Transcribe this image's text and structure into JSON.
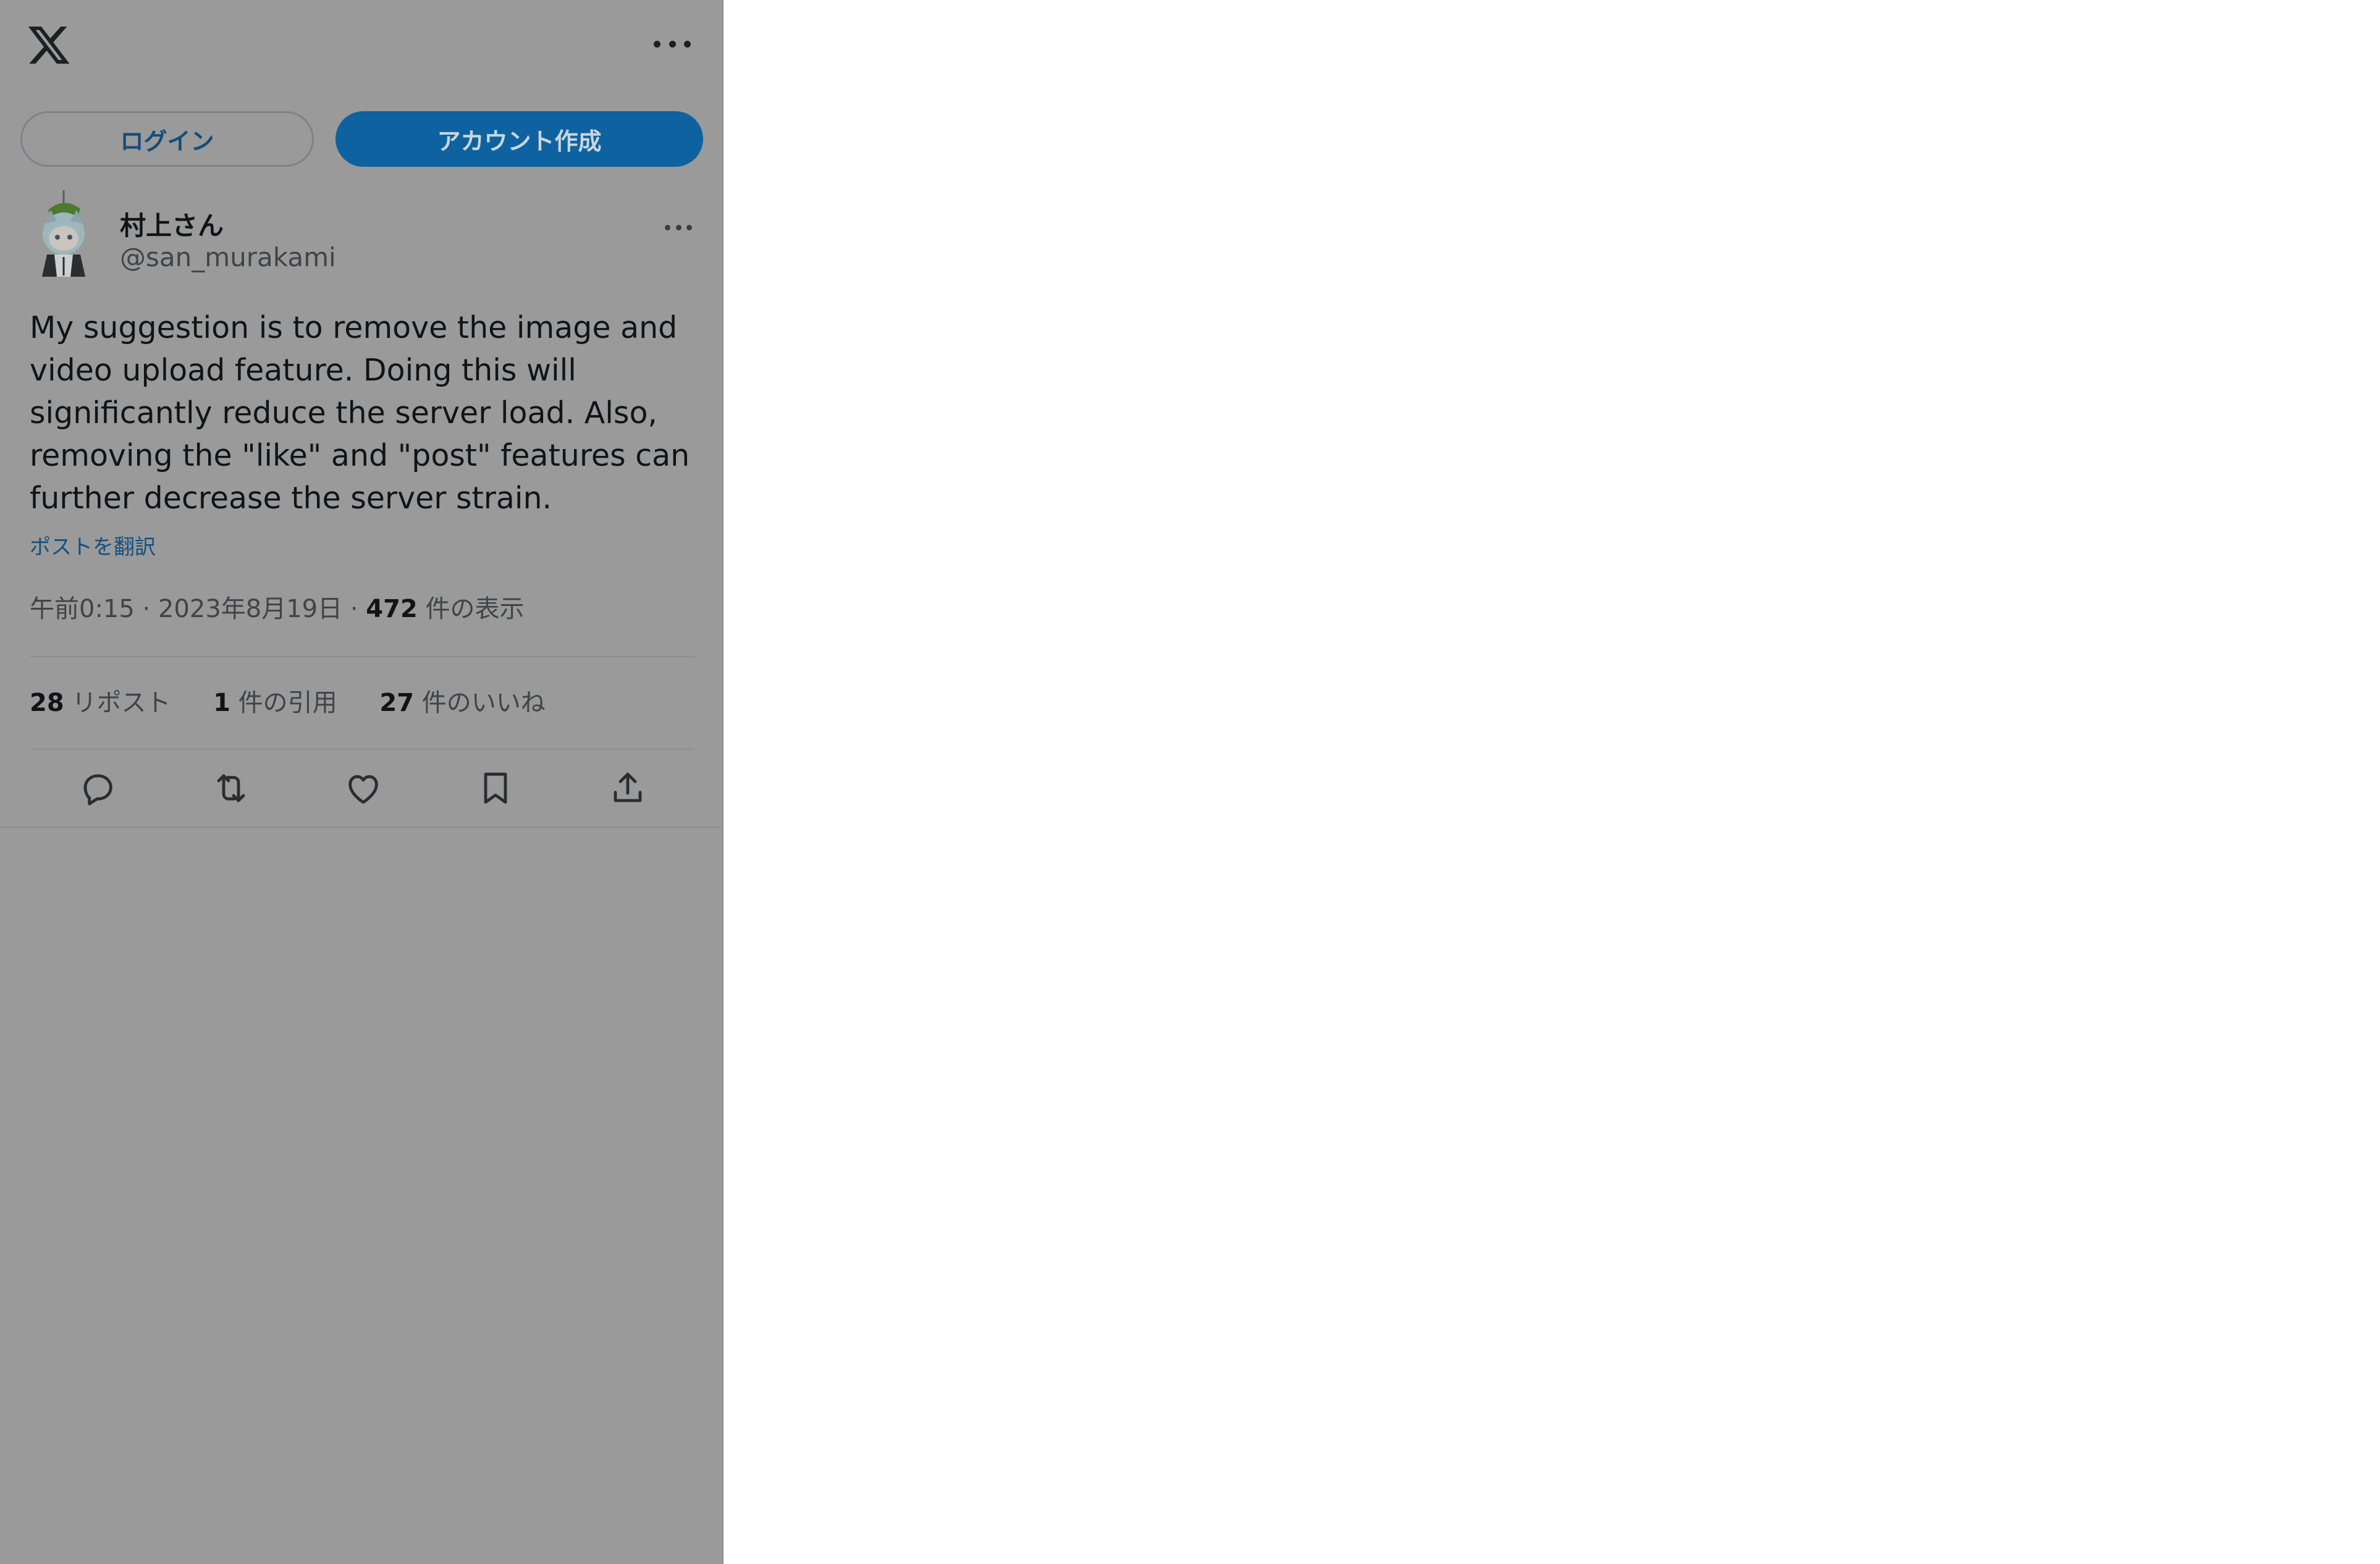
{
  "window": {
    "logo_icon": "x-logo-icon",
    "more_icon": "more-horizontal-icon"
  },
  "auth": {
    "login_label": "ログイン",
    "signup_label": "アカウント作成"
  },
  "post": {
    "author_name": "村上さん",
    "author_handle": "@san_murakami",
    "text": "My suggestion is to remove the image and video upload feature. Doing this will significantly reduce the server load. Also, removing the \"like\" and \"post\" features can further decrease the server strain.",
    "translate_label": "ポストを翻訳",
    "time": "午前0:15",
    "date": "2023年8月19日",
    "views_count": "472",
    "views_label": "件の表示",
    "separator": "·",
    "stats": {
      "reposts_count": "28",
      "reposts_label": "リポスト",
      "quotes_count": "1",
      "quotes_label": "件の引用",
      "likes_count": "27",
      "likes_label": "件のいいね"
    },
    "action_icons": [
      "reply-icon",
      "repost-icon",
      "like-icon",
      "bookmark-icon",
      "share-icon"
    ]
  },
  "colors": {
    "overlay_gray": "#9a9a9a",
    "signup_button": "#0f62a0",
    "link_blue": "#144f7e",
    "background_right": "#ffffff"
  }
}
